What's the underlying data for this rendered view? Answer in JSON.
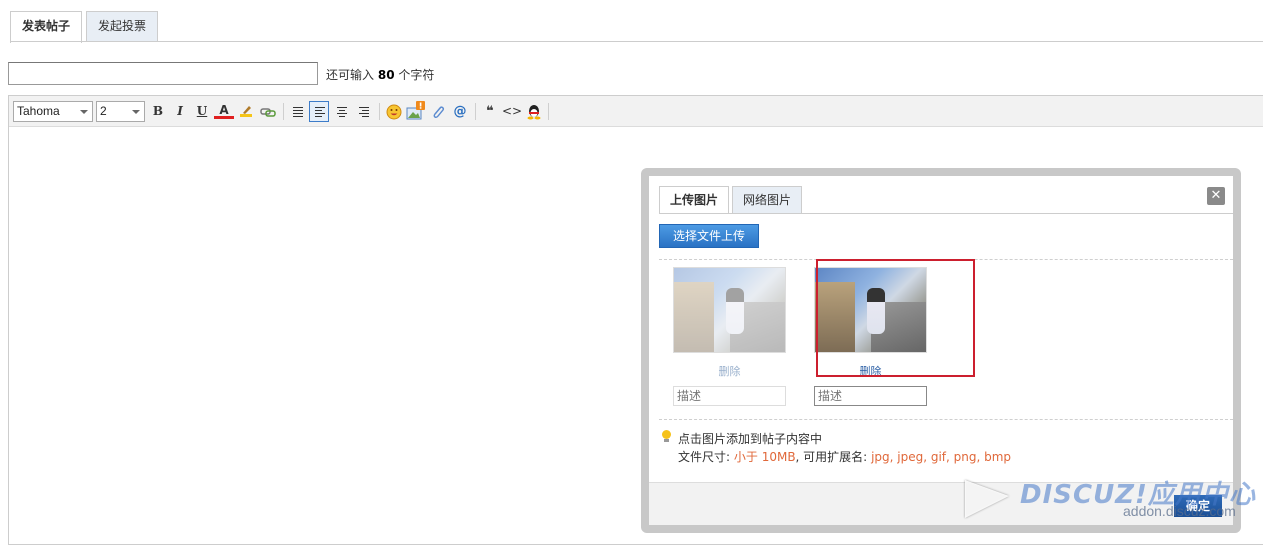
{
  "main_tabs": [
    {
      "label": "发表帖子",
      "active": true
    },
    {
      "label": "发起投票",
      "active": false
    }
  ],
  "subject": {
    "value": "",
    "hint_prefix": "还可输入",
    "hint_count": "80",
    "hint_suffix": "个字符"
  },
  "toolbar": {
    "font_family": "Tahoma",
    "font_size": "2",
    "bold": "B",
    "italic": "I",
    "underline": "U",
    "font_color": "A",
    "quote": "❝",
    "code": "<>"
  },
  "dialog": {
    "tabs": [
      {
        "label": "上传图片",
        "active": true
      },
      {
        "label": "网络图片",
        "active": false
      }
    ],
    "close_label": "✕",
    "upload_button": "选择文件上传",
    "images": [
      {
        "delete_label": "删除",
        "description_placeholder": "描述",
        "faded": true
      },
      {
        "delete_label": "删除",
        "description_placeholder": "描述",
        "faded": false
      }
    ],
    "tip": "点击图片添加到帖子内容中",
    "size_label": "文件尺寸:",
    "size_value": "小于 10MB",
    "ext_label": ", 可用扩展名:",
    "ext_value": "jpg, jpeg, gif, png, bmp",
    "confirm_button": "确定"
  },
  "watermark": {
    "title": "DISCUZ!应用中心",
    "url": "addon.discuz.com"
  },
  "colors": {
    "accent": "#2a72c4",
    "highlight_text": "#e0683a",
    "selection_box": "#cc1f2e"
  }
}
